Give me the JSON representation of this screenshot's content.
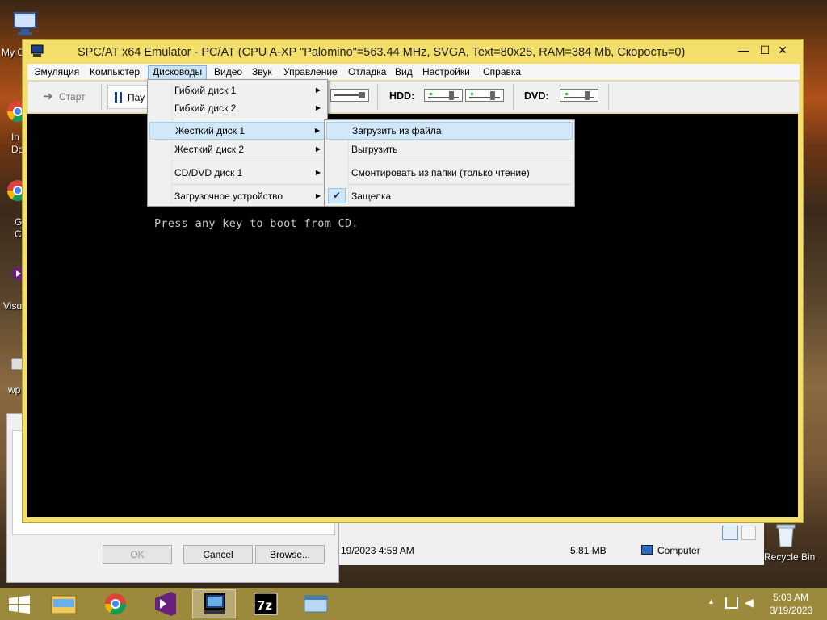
{
  "desktop": {
    "labels": [
      "My C",
      "In",
      "Do",
      "G",
      "C",
      "Visu",
      "wp"
    ],
    "recycle_bin": "Recycle Bin"
  },
  "bg_dialog": {
    "ok": "OK",
    "cancel": "Cancel",
    "browse": "Browse..."
  },
  "explorer": {
    "date": "19/2023 4:58 AM",
    "size": "5.81 MB",
    "location": "Computer"
  },
  "window": {
    "title": "SPC/AT x64 Emulator - PC/AT (CPU A-XP \"Palomino\"=563.44 MHz, SVGA, Text=80x25, RAM=384 Mb, Скорость=0)",
    "minimize": "—",
    "maximize": "☐",
    "close": "✕"
  },
  "menubar": {
    "items": [
      "Эмуляция",
      "Компьютер",
      "Дисководы",
      "Видео",
      "Звук",
      "Управление",
      "Отладка",
      "Вид",
      "Настройки",
      "Справка"
    ]
  },
  "toolbar": {
    "start": "Старт",
    "pause": "Пау",
    "hdd": "HDD:",
    "dvd": "DVD:"
  },
  "screen": {
    "text": "Press any key to boot from CD."
  },
  "drives_menu": {
    "items": [
      "Гибкий диск 1",
      "Гибкий диск 2",
      "Жесткий диск 1",
      "Жесткий диск 2",
      "CD/DVD диск 1",
      "Загрузочное устройство"
    ]
  },
  "hdd1_submenu": {
    "items": [
      "Загрузить из файла",
      "Выгрузить",
      "Смонтировать из папки (только чтение)",
      "Защелка"
    ],
    "latch_checked": true
  },
  "tray": {
    "time": "5:03 AM",
    "date": "3/19/2023"
  },
  "colors": {
    "window_frame": "#f4df6a",
    "menu_highlight": "#d1e8fb",
    "taskbar": "#9b8a3c"
  }
}
